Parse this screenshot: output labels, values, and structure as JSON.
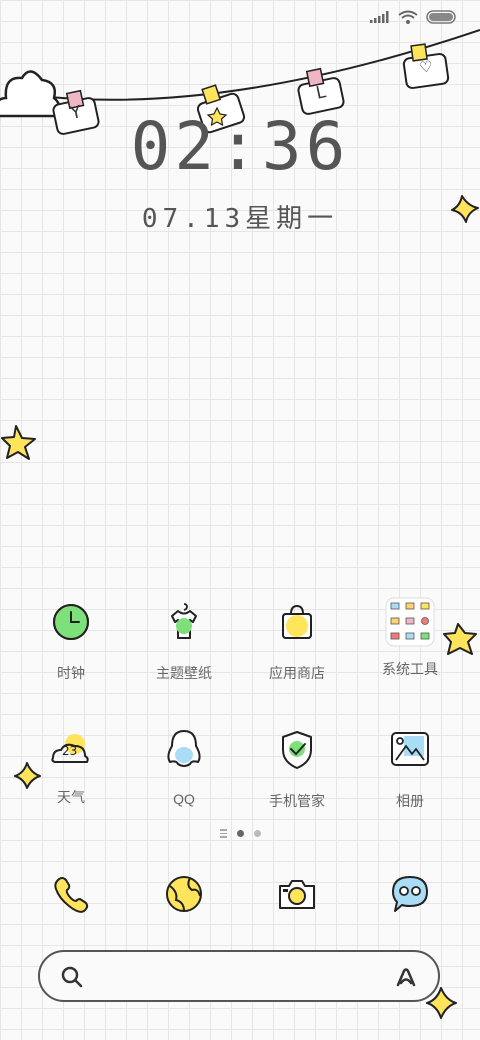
{
  "status_bar": {
    "signal_icon": "signal-icon",
    "wifi_icon": "wifi-icon",
    "battery_icon": "battery-icon"
  },
  "clock": {
    "time": "02:36",
    "date": "07.13星期一"
  },
  "hanging_cards": [
    "Y",
    "L",
    "♡"
  ],
  "apps_row1": [
    {
      "label": "时钟",
      "icon": "clock-icon"
    },
    {
      "label": "主题壁纸",
      "icon": "tshirt-icon"
    },
    {
      "label": "应用商店",
      "icon": "shopping-bag-icon"
    },
    {
      "label": "系统工具",
      "icon": "folder-icon"
    }
  ],
  "apps_row2": [
    {
      "label": "天气",
      "icon": "weather-icon",
      "badge": "23"
    },
    {
      "label": "QQ",
      "icon": "penguin-icon"
    },
    {
      "label": "手机管家",
      "icon": "shield-icon"
    },
    {
      "label": "相册",
      "icon": "gallery-icon"
    }
  ],
  "pager": {
    "pages": 2,
    "current": 1
  },
  "dock": [
    {
      "icon": "phone-icon"
    },
    {
      "icon": "browser-icon"
    },
    {
      "icon": "camera-icon"
    },
    {
      "icon": "messages-icon"
    }
  ],
  "search": {
    "icon": "search-icon",
    "assistant_icon": "assistant-icon"
  },
  "colors": {
    "accent_yellow": "#ffe45c",
    "accent_green": "#7ee07a",
    "accent_blue": "#a9dcf5",
    "ink": "#444444"
  }
}
